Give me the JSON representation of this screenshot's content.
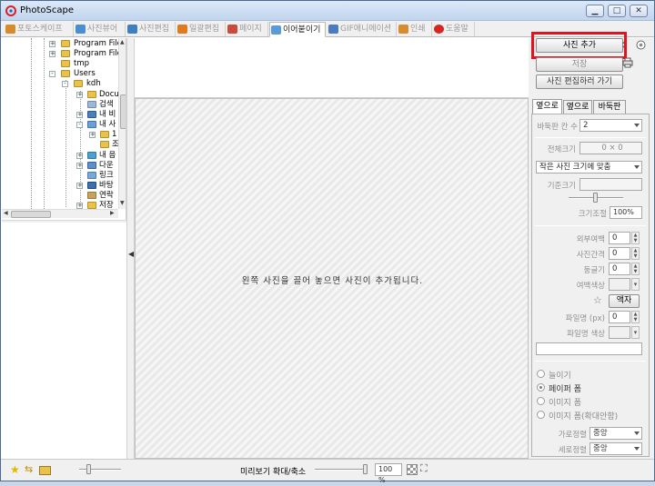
{
  "window": {
    "title": "PhotoScape",
    "buttons": [
      "minimize",
      "maximize",
      "close"
    ]
  },
  "tabs": [
    {
      "label": "포토스케이프",
      "color": "#d98a2b",
      "active": false
    },
    {
      "label": "사진뷰어",
      "color": "#4a8fd1",
      "active": false
    },
    {
      "label": "사진편집",
      "color": "#3f7fbf",
      "active": false
    },
    {
      "label": "일괄편집",
      "color": "#e07a1f",
      "active": false
    },
    {
      "label": "페이지",
      "color": "#c94b3b",
      "active": false
    },
    {
      "label": "이어붙이기",
      "color": "#5a9ad6",
      "active": true
    },
    {
      "label": "GIF애니메이션",
      "color": "#4b7bbf",
      "active": false
    },
    {
      "label": "인쇄",
      "color": "#d88c2e",
      "active": false
    },
    {
      "label": "도움말",
      "color": "#d6261e",
      "active": false
    }
  ],
  "tree": {
    "items": [
      {
        "label": "Program File",
        "expander": "+"
      },
      {
        "label": "Program File",
        "expander": "+"
      },
      {
        "label": "tmp",
        "expander": ""
      },
      {
        "label": "Users",
        "expander": "-"
      },
      {
        "label": "kdh",
        "expander": "-"
      },
      {
        "label": "Docu",
        "expander": "+"
      },
      {
        "label": "검색",
        "expander": ""
      },
      {
        "label": "내 비",
        "expander": "+"
      },
      {
        "label": "내 사",
        "expander": "-"
      },
      {
        "label": "1",
        "expander": "+"
      },
      {
        "label": "조",
        "expander": ""
      },
      {
        "label": "내 음",
        "expander": "+"
      },
      {
        "label": "다운",
        "expander": "+"
      },
      {
        "label": "링크",
        "expander": ""
      },
      {
        "label": "바탕",
        "expander": "+"
      },
      {
        "label": "연락",
        "expander": ""
      },
      {
        "label": "저장",
        "expander": "+"
      }
    ]
  },
  "canvas": {
    "message": "왼쪽 사진을 끌어 놓으면 사진이 추가됩니다."
  },
  "right_panel": {
    "add_photo": "사진 추가",
    "save": "저장",
    "go_edit": "사진 편집하러 가기",
    "subtabs": [
      "옆으로",
      "옆으로",
      "바둑판"
    ],
    "grid_count_label": "바둑판 칸 수",
    "grid_count_value": "2",
    "total_size_label": "전체크기",
    "total_size_value": "0 × 0",
    "fit_option": "작은 사진 크기에 맞춤",
    "base_size_label": "기준크기",
    "resize_label": "크기조절",
    "resize_value": "100%",
    "outer_margin_label": "외부여백",
    "outer_margin_value": "0",
    "photo_gap_label": "사진간격",
    "photo_gap_value": "0",
    "rounded_label": "둥글기",
    "rounded_value": "0",
    "margin_color_label": "여백색상",
    "frame_button": "액자",
    "filename_label": "파일명 (px)",
    "filename_value": "0",
    "filename_color_label": "파일명 색상",
    "radios": [
      {
        "label": "늘이기",
        "checked": false
      },
      {
        "label": "페이퍼 폼",
        "checked": true
      },
      {
        "label": "이미지 폼",
        "checked": false
      },
      {
        "label": "이미지 폼(확대안함)",
        "checked": false
      }
    ],
    "h_align_label": "가로정렬",
    "h_align_value": "중앙",
    "v_align_label": "세로정렬",
    "v_align_value": "중앙"
  },
  "statusbar": {
    "preview_label": "미리보기 확대/축소",
    "zoom_value": "100 %"
  },
  "colors": {
    "highlight": "#e0141e",
    "titlebar": "#c2d5ee"
  }
}
